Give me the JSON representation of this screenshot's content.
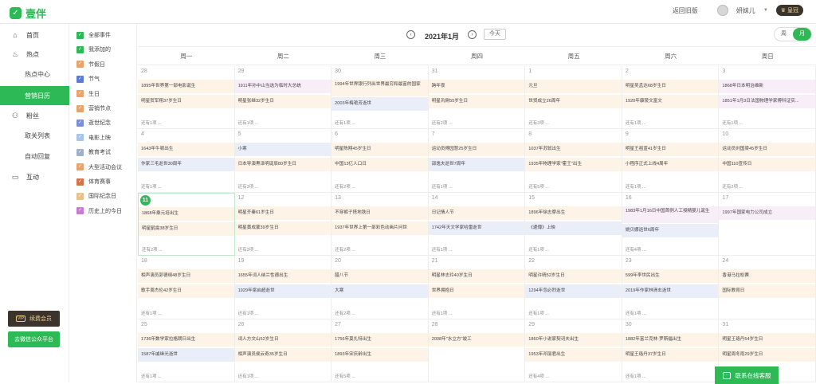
{
  "app": {
    "name": "壹伴"
  },
  "header": {
    "back_label": "返回旧版",
    "username": "妍妹儿",
    "vip_label": "皇冠"
  },
  "sidebar": {
    "items": [
      {
        "label": "首页",
        "icon": "home-icon"
      },
      {
        "label": "热点",
        "icon": "fire-icon"
      },
      {
        "label": "热点中心",
        "icon": ""
      },
      {
        "label": "营销日历",
        "icon": ""
      },
      {
        "label": "粉丝",
        "icon": "user-icon"
      },
      {
        "label": "取关列表",
        "icon": ""
      },
      {
        "label": "自动回复",
        "icon": ""
      },
      {
        "label": "互动",
        "icon": "chat-icon"
      }
    ],
    "vip_button": "续费会员",
    "vip_tag": "VIP",
    "wx_button": "去微信公众平台"
  },
  "filters": [
    {
      "label": "全部事件",
      "color": "#2db955"
    },
    {
      "label": "我添加的",
      "color": "#2db955"
    },
    {
      "label": "节假日",
      "color": "#e8a46a"
    },
    {
      "label": "节气",
      "color": "#5b7bd5"
    },
    {
      "label": "生日",
      "color": "#e8a46a"
    },
    {
      "label": "营销节点",
      "color": "#e8a46a"
    },
    {
      "label": "逝世纪念",
      "color": "#7a8fd8"
    },
    {
      "label": "电影上映",
      "color": "#a8c4e8"
    },
    {
      "label": "教育考试",
      "color": "#9fb0c8"
    },
    {
      "label": "大型活动会议",
      "color": "#e8a46a"
    },
    {
      "label": "体育赛事",
      "color": "#d4734a"
    },
    {
      "label": "国际纪念日",
      "color": "#e8c08a"
    },
    {
      "label": "历史上的今日",
      "color": "#c77bcf"
    }
  ],
  "toolbar": {
    "prev": "‹",
    "next": "›",
    "month": "2021年1月",
    "today": "今天",
    "view_week": "周",
    "view_month": "月"
  },
  "weekdays": [
    "周一",
    "周二",
    "周三",
    "周四",
    "周五",
    "周六",
    "周日"
  ],
  "more_label": "还有1项 ...",
  "customer_service": "联系在线客服",
  "today_day": "11",
  "calendar": [
    [
      {
        "day": "28",
        "events": [
          {
            "t": "1895年世界第一部电影诞生",
            "c": "o"
          },
          {
            "t": "明星贺军翔37岁生日",
            "c": "o"
          }
        ],
        "more": "还有1项 ..."
      },
      {
        "day": "29",
        "events": [
          {
            "t": "1911年孙中山当选为临时大总统",
            "c": "p"
          },
          {
            "t": "明星张继32岁生日",
            "c": "o"
          }
        ],
        "more": "还有1项 ..."
      },
      {
        "day": "30",
        "events": [
          {
            "t": "1994年世界银行列出世界最穷和最富的国家",
            "c": "o",
            "tall": true
          },
          {
            "t": "2003年梅艳芳逝世",
            "c": "b"
          }
        ],
        "more": "还有1项 ..."
      },
      {
        "day": "31",
        "events": [
          {
            "t": "跨年夜",
            "c": "o"
          },
          {
            "t": "明星巩俐55岁生日",
            "c": "o"
          }
        ],
        "more": "还有2项 ..."
      },
      {
        "day": "1",
        "events": [
          {
            "t": "元旦",
            "c": "o"
          },
          {
            "t": "世贸成立26周年",
            "c": "o"
          }
        ],
        "more": "还有3项 ..."
      },
      {
        "day": "2",
        "events": [
          {
            "t": "明星吴孟达68岁生日",
            "c": "o"
          },
          {
            "t": "1920年康陵文富文",
            "c": "o"
          }
        ],
        "more": "还有1项 ..."
      },
      {
        "day": "3",
        "events": [
          {
            "t": "1868年日本明治维新",
            "c": "p"
          },
          {
            "t": "1851年1月3日法国物理学家傅科证实...",
            "c": "p"
          }
        ],
        "more": "还有1项 ..."
      }
    ],
    [
      {
        "day": "4",
        "events": [
          {
            "t": "1643年牛顿出生",
            "c": "o"
          },
          {
            "t": "作家三毛逝世30周年",
            "c": "b"
          }
        ],
        "more": "还有1项 ..."
      },
      {
        "day": "5",
        "events": [
          {
            "t": "小寒",
            "c": "b"
          },
          {
            "t": "日本导演黑泽明诞辰80岁生日",
            "c": "o"
          }
        ],
        "more": "还有3项 ..."
      },
      {
        "day": "6",
        "events": [
          {
            "t": "明星陈翔45岁生日",
            "c": "o"
          },
          {
            "t": "中国13亿人口日",
            "c": "o"
          }
        ],
        "more": "还有2项 ..."
      },
      {
        "day": "7",
        "events": [
          {
            "t": "运动员傅园慧25岁生日",
            "c": "o"
          },
          {
            "t": "邵逸夫逝世7周年",
            "c": "b"
          }
        ],
        "more": "还有1项 ..."
      },
      {
        "day": "8",
        "events": [
          {
            "t": "1037年苏轼出生",
            "c": "o"
          },
          {
            "t": "1935年物理学家\"霍王\"出生",
            "c": "o"
          }
        ],
        "more": "还有5项 ..."
      },
      {
        "day": "9",
        "events": [
          {
            "t": "明星王祖蓝41岁生日",
            "c": "o"
          },
          {
            "t": "小程序正式上线4周年",
            "c": "o"
          }
        ],
        "more": "还有1项 ..."
      },
      {
        "day": "10",
        "events": [
          {
            "t": "运动员刘国梁45岁生日",
            "c": "o"
          },
          {
            "t": "中国110宣传日",
            "c": "o"
          }
        ],
        "more": "还有2项 ..."
      }
    ],
    [
      {
        "day": "11",
        "events": [
          {
            "t": "1868年桑元培出生",
            "c": "o"
          },
          {
            "t": "明星鹤龛38岁生日",
            "c": "o"
          }
        ],
        "more": "还有2项 ..."
      },
      {
        "day": "12",
        "events": [
          {
            "t": "明星齐秦61岁生日",
            "c": "o"
          },
          {
            "t": "明星黄成蒙39岁生日",
            "c": "o"
          }
        ],
        "more": "还有3项 ..."
      },
      {
        "day": "13",
        "events": [
          {
            "t": "不穿裤子搭地铁日",
            "c": "o"
          },
          {
            "t": "1937年世界上第一部彩色动画片问世",
            "c": "o"
          }
        ],
        "more": "还有2项 ..."
      },
      {
        "day": "14",
        "events": [
          {
            "t": "日记情人节",
            "c": "o"
          },
          {
            "t": "1742年天文学家哈雷逝世",
            "c": "b"
          }
        ],
        "more": "还有1项 ..."
      },
      {
        "day": "15",
        "events": [
          {
            "t": "1896年徐志摩出生",
            "c": "o"
          },
          {
            "t": "《邊傳》上映",
            "c": "b"
          }
        ],
        "more": "还有1项 ..."
      },
      {
        "day": "16",
        "events": [
          {
            "t": "1983年1月16日中国首例人工授精婴儿诞生",
            "c": "p",
            "tall": true
          },
          {
            "t": "姚贝娜逝世6周年",
            "c": "b"
          }
        ],
        "more": "还有4项 ..."
      },
      {
        "day": "17",
        "events": [
          {
            "t": "1997年国家电力公司成立",
            "c": "p"
          }
        ],
        "more": ""
      }
    ],
    [
      {
        "day": "18",
        "events": [
          {
            "t": "相声演员郭德纲48岁生日",
            "c": "o"
          },
          {
            "t": "歌手周杰伦42岁生日",
            "c": "o"
          }
        ],
        "more": "还有1项 ..."
      },
      {
        "day": "19",
        "events": [
          {
            "t": "1655年词人纳兰性德出生",
            "c": "o"
          },
          {
            "t": "1929年梁启超逝世",
            "c": "b"
          }
        ],
        "more": "还有1项 ..."
      },
      {
        "day": "20",
        "events": [
          {
            "t": "腊八节",
            "c": "o"
          },
          {
            "t": "大寒",
            "c": "b"
          }
        ],
        "more": "还有2项 ..."
      },
      {
        "day": "21",
        "events": [
          {
            "t": "明星林志玲40岁生日",
            "c": "o"
          },
          {
            "t": "世界拥抱日",
            "c": "o"
          }
        ],
        "more": "还有1项 ..."
      },
      {
        "day": "22",
        "events": [
          {
            "t": "明星许晴52岁生日",
            "c": "o"
          },
          {
            "t": "1294年忽必烈逝世",
            "c": "b"
          }
        ],
        "more": "还有1项 ..."
      },
      {
        "day": "23",
        "events": [
          {
            "t": "599年李世民出生",
            "c": "o"
          },
          {
            "t": "2019年作家林清玄逝世",
            "c": "b"
          }
        ],
        "more": "还有1项 ..."
      },
      {
        "day": "24",
        "events": [
          {
            "t": "香港马拉松赛",
            "c": "o"
          },
          {
            "t": "国际教育日",
            "c": "o"
          }
        ],
        "more": ""
      }
    ],
    [
      {
        "day": "25",
        "events": [
          {
            "t": "1736年数学家拉格朗日出生",
            "c": "o"
          },
          {
            "t": "1587年戚继光逝世",
            "c": "b"
          }
        ],
        "more": "还有1项 ..."
      },
      {
        "day": "26",
        "events": [
          {
            "t": "词人方文山52岁生日",
            "c": "o"
          },
          {
            "t": "相声演员侯云奇35岁生日",
            "c": "o"
          }
        ],
        "more": "还有1项 ..."
      },
      {
        "day": "27",
        "events": [
          {
            "t": "1756年莫扎特出生",
            "c": "o"
          },
          {
            "t": "1893年宋庆龄出生",
            "c": "o"
          }
        ],
        "more": "还有5项 ..."
      },
      {
        "day": "28",
        "events": [
          {
            "t": "2008年\"水立方\"竣工",
            "c": "o"
          }
        ],
        "more": ""
      },
      {
        "day": "29",
        "events": [
          {
            "t": "1860年小说家契诃夫出生",
            "c": "o"
          },
          {
            "t": "1953年邓丽君出生",
            "c": "o"
          }
        ],
        "more": "还有4项 ..."
      },
      {
        "day": "30",
        "events": [
          {
            "t": "1882年富兰克林·罗斯福出生",
            "c": "o"
          },
          {
            "t": "明星王珞丹37岁生日",
            "c": "o"
          }
        ],
        "more": "还有1项 ..."
      },
      {
        "day": "31",
        "events": [
          {
            "t": "明星王珞丹54岁生日",
            "c": "o"
          },
          {
            "t": "明星周冬雨29岁生日",
            "c": "o"
          }
        ],
        "more": ""
      }
    ]
  ]
}
